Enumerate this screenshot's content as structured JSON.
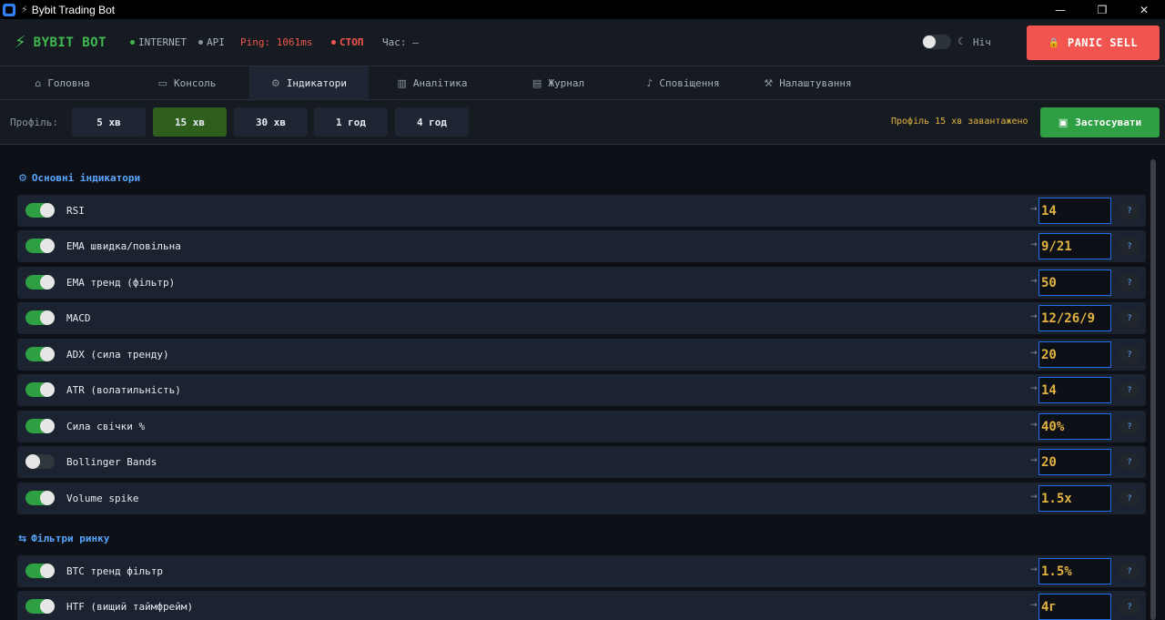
{
  "window": {
    "title": "Bybit Trading Bot",
    "title_icon": "bolt-icon",
    "controls": [
      "—",
      "❐",
      "✕"
    ]
  },
  "header": {
    "brand": "BYBIT BOT",
    "internet_label": "INTERNET",
    "api_label": "API",
    "ping_text": "Ping: 1061ms",
    "stop_label": "СТОП",
    "time_text": "Час: —",
    "night_label": "Ніч",
    "panic_label": "PANIC SELL",
    "colors": {
      "green": "#3fb950",
      "red": "#f2554f",
      "ping": "#f2554f",
      "accent": "#58a6ff"
    }
  },
  "tabs": [
    {
      "label": "Головна",
      "icon": "home-icon"
    },
    {
      "label": "Консоль",
      "icon": "console-icon"
    },
    {
      "label": "Індикатори",
      "icon": "gear-icon",
      "active": true
    },
    {
      "label": "Аналітика",
      "icon": "bar-chart-icon"
    },
    {
      "label": "Журнал",
      "icon": "journal-icon"
    },
    {
      "label": "Сповіщення",
      "icon": "bell-icon"
    },
    {
      "label": "Налаштування",
      "icon": "wrench-icon"
    }
  ],
  "profile": {
    "label": "Профіль:",
    "options": [
      "5 хв",
      "15 хв",
      "30 хв",
      "1 год",
      "4 год"
    ],
    "selected": "15 хв",
    "status": "Профіль 15 хв завантажено",
    "apply_label": "Застосувати"
  },
  "sections": {
    "main_title": "Основні індикатори",
    "filters_title": "Фільтри ринку"
  },
  "indicators": [
    {
      "label": "RSI",
      "value": "14",
      "enabled": true
    },
    {
      "label": "EMA швидка/повільна",
      "value": "9/21",
      "enabled": true
    },
    {
      "label": "EMA тренд (фільтр)",
      "value": "50",
      "enabled": true
    },
    {
      "label": "MACD",
      "value": "12/26/9",
      "enabled": true
    },
    {
      "label": "ADX (сила тренду)",
      "value": "20",
      "enabled": true
    },
    {
      "label": "ATR (волатильність)",
      "value": "14",
      "enabled": true
    },
    {
      "label": "Сила свічки %",
      "value": "40%",
      "enabled": true
    },
    {
      "label": "Bollinger Bands",
      "value": "20",
      "enabled": false
    },
    {
      "label": "Volume spike",
      "value": "1.5x",
      "enabled": true
    }
  ],
  "filters": [
    {
      "label": "BTC тренд фільтр",
      "value": "1.5%",
      "enabled": true
    },
    {
      "label": "HTF (вищий таймфрейм)",
      "value": "4г",
      "enabled": true
    }
  ],
  "help_label": "?",
  "arrow_glyph": "→"
}
